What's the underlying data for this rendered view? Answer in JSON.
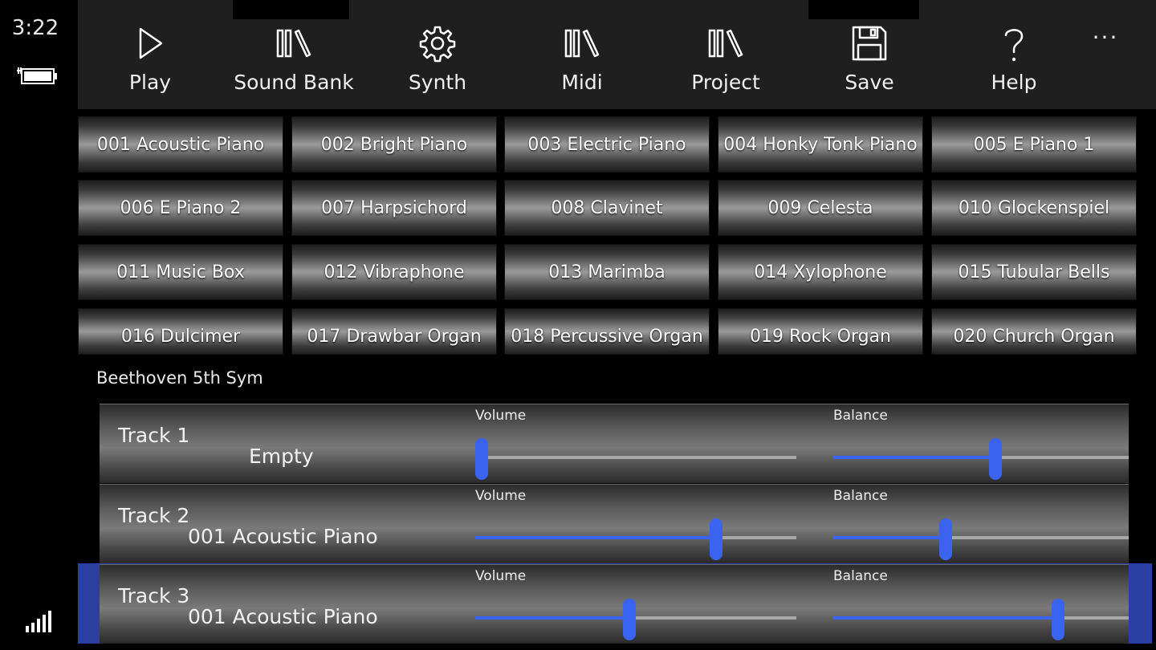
{
  "status": {
    "time": "3:22",
    "battery_icon": "battery-charging-icon",
    "signal_icon": "signal-bars-icon"
  },
  "appbar": {
    "commands": [
      {
        "label": "Play",
        "icon": "play-icon"
      },
      {
        "label": "Sound Bank",
        "icon": "library-icon"
      },
      {
        "label": "Synth",
        "icon": "gear-icon"
      },
      {
        "label": "Midi",
        "icon": "library-icon"
      },
      {
        "label": "Project",
        "icon": "library-icon"
      },
      {
        "label": "Save",
        "icon": "floppy-disk-icon"
      },
      {
        "label": "Help",
        "icon": "question-mark-icon"
      }
    ],
    "more": "···"
  },
  "instruments": [
    "001 Acoustic Piano",
    "002 Bright Piano",
    "003 Electric Piano",
    "004 Honky Tonk Piano",
    "005 E Piano 1",
    "006 E Piano 2",
    "007 Harpsichord",
    "008 Clavinet",
    "009 Celesta",
    "010 Glockenspiel",
    "011 Music Box",
    "012 Vibraphone",
    "013 Marimba",
    "014 Xylophone",
    "015 Tubular Bells",
    "016 Dulcimer",
    "017 Drawbar Organ",
    "018 Percussive Organ",
    "019 Rock Organ",
    "020 Church Organ"
  ],
  "project": {
    "title": "Beethoven 5th Sym"
  },
  "tracks": [
    {
      "name": "Track 1",
      "instrument": "Empty",
      "volume_label": "Volume",
      "volume": 0.02,
      "balance_label": "Balance",
      "balance": 0.55,
      "selected": false
    },
    {
      "name": "Track 2",
      "instrument": "001 Acoustic Piano",
      "volume_label": "Volume",
      "volume": 0.75,
      "balance_label": "Balance",
      "balance": 0.38,
      "selected": false
    },
    {
      "name": "Track 3",
      "instrument": "001 Acoustic Piano",
      "volume_label": "Volume",
      "volume": 0.48,
      "balance_label": "Balance",
      "balance": 0.76,
      "selected": true
    }
  ],
  "colors": {
    "accent": "#3a63f0",
    "selection": "#2a3fa0"
  }
}
